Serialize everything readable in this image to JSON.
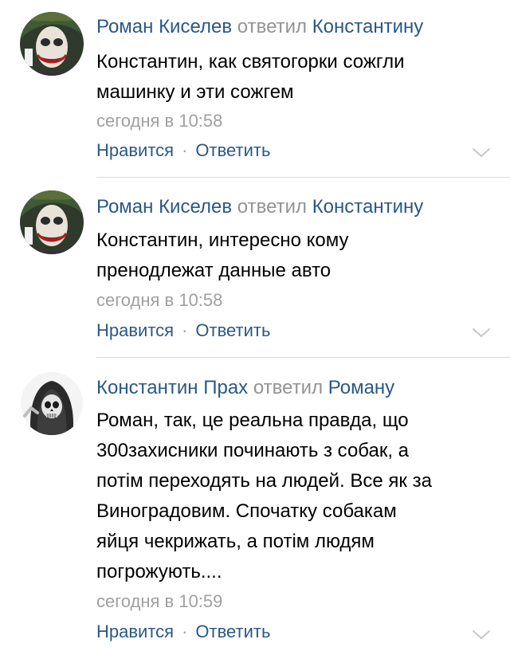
{
  "comments": [
    {
      "author": "Роман Киселев",
      "replied_word": "ответил",
      "reply_to": "Константину",
      "text_lines": [
        "Константин, как святогорки сожгли",
        "машинку и эти сожгем"
      ],
      "time": "сегодня в 10:58",
      "like_label": "Нравится",
      "separator": "·",
      "reply_label": "Ответить",
      "avatar_icon": "joker-avatar-icon",
      "chevron_icon": "chevron-down-icon"
    },
    {
      "author": "Роман Киселев",
      "replied_word": "ответил",
      "reply_to": "Константину",
      "text_lines": [
        "Константин, интересно кому",
        "пренодлежат данные авто"
      ],
      "time": "сегодня в 10:58",
      "like_label": "Нравится",
      "separator": "·",
      "reply_label": "Ответить",
      "avatar_icon": "joker-avatar-icon",
      "chevron_icon": "chevron-down-icon"
    },
    {
      "author": "Константин Прах",
      "replied_word": "ответил",
      "reply_to": "Роману",
      "text_lines": [
        "Роман, так, це реальна правда, що",
        "300захисники починають з собак, а",
        "потім переходять на людей. Все як за",
        "Виноградовим. Спочатку собакам",
        "яйця чекрижать, а потім людям",
        "погрожують...."
      ],
      "time": "сегодня в 10:59",
      "like_label": "Нравится",
      "separator": "·",
      "reply_label": "Ответить",
      "avatar_icon": "skull-avatar-icon",
      "chevron_icon": "chevron-down-icon"
    }
  ],
  "colors": {
    "link": "#2a5885",
    "meta": "#a0a0a0",
    "text": "#000000",
    "divider": "#dcdcdc"
  }
}
